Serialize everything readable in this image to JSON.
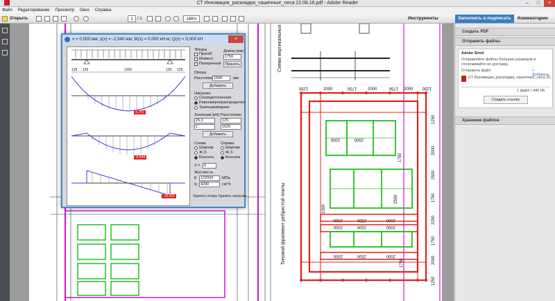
{
  "window": {
    "title": "СТ Инновация_раскладка_чашечные_леса 22.08.16.pdf - Adobe Reader"
  },
  "menu": [
    "Файл",
    "Редактирование",
    "Просмотр",
    "Окно",
    "Справка"
  ],
  "toolbar": {
    "open_label": "Открыть",
    "page_current": "1",
    "page_total": "/ 1",
    "zoom": "186%",
    "tools_label": "Инструменты",
    "fill_sign_label": "Заполнить и подписать",
    "comments_label": "Комментарии"
  },
  "right_panel": {
    "create_pdf": "Создать PDF",
    "send_files": "Отправить файлы",
    "adobe_send": "Adobe Send",
    "adobe_send_desc": "Отправляйте файлы больших размеров и отслеживайте их доставку.",
    "send_file_label": "Отправить файл",
    "add_label": "+ Добавить",
    "file_name": "СТ Инновация_раскладка_чашечные_леса 22.08...",
    "file_info": "1 файл / 440 КБ",
    "create_link_button": "Создать ссылку",
    "storage": "Хранение файлов"
  },
  "calc": {
    "header": "x = 0,000 мм;    y(x) = -2,340 мм;    M(x) = 0,000 кН·м;    Q(x) = 0,000 кН",
    "ctrl": {
      "epures_label": "Эпюры",
      "chk_deflection": "Прогиб",
      "chk_moment": "Момент",
      "chk_shear": "Поперечная",
      "length_label": "Длина (мм)",
      "length_value": "1750",
      "apply_button": "Принять",
      "support_label": "Опора",
      "distance_label": "Расстояние",
      "distance_value": "1500",
      "mm": "мм",
      "add_button": "Добавить",
      "load_label": "Нагрузка",
      "load_concentrated": "Сосредоточенная",
      "load_uniform": "Равномернораспределен",
      "load_trapezoid": "Трапециевидная",
      "value_kn": "Значение [кН]",
      "distance_col": "Расстояние",
      "v1": "25,3",
      "d1": "125",
      "v2": "1",
      "d2": "1625",
      "add_button2": "Добавить",
      "left_label": "Слева",
      "right_label": "Справа",
      "hinge": "Шарнир",
      "fixed": "Ж.З.",
      "console": "Консоль",
      "x_label": "X =",
      "x_value": "0",
      "stiffness_label": "Жесткость",
      "e_label": "E",
      "e_value": "122000",
      "e_unit": "МПа",
      "iy_label": "Iy",
      "iy_value": "4290",
      "iy_unit": "см^4",
      "delete_link": "Удалить опоры Удалить нагрузки"
    },
    "dims": {
      "d1": "125",
      "d2": "125",
      "d3": "1250",
      "d4": "125",
      "d5": "125"
    },
    "values": {
      "moment_max": "3,751",
      "shear": "-6,544",
      "deflection": "-15,815"
    }
  },
  "drawing": {
    "vertical_title": "Схема вертикальных",
    "fragment_title": "Типовой фрагмент ребристой плиты",
    "top_dims": [
      "1250",
      "2000",
      "1750",
      "2000",
      "1750",
      "2000",
      "1250"
    ],
    "right_dims": [
      "1250",
      "2000",
      "2500",
      "1750",
      "2250",
      "1750",
      "2000",
      "1250"
    ],
    "inner_h": [
      "2000",
      "2500"
    ],
    "inner_v": [
      "1750",
      "2500",
      "1750"
    ],
    "inner_h2": [
      "2000",
      "2500",
      "2000"
    ],
    "inner_h3": [
      "2000",
      "2500",
      "2000"
    ],
    "inner_h4": [
      "2000",
      "2500",
      "2000"
    ],
    "inner_left": "1000"
  },
  "colors": {
    "accent": "#4b86c9",
    "red": "#e0201c",
    "green": "#20c020",
    "magenta": "#d010d0"
  }
}
